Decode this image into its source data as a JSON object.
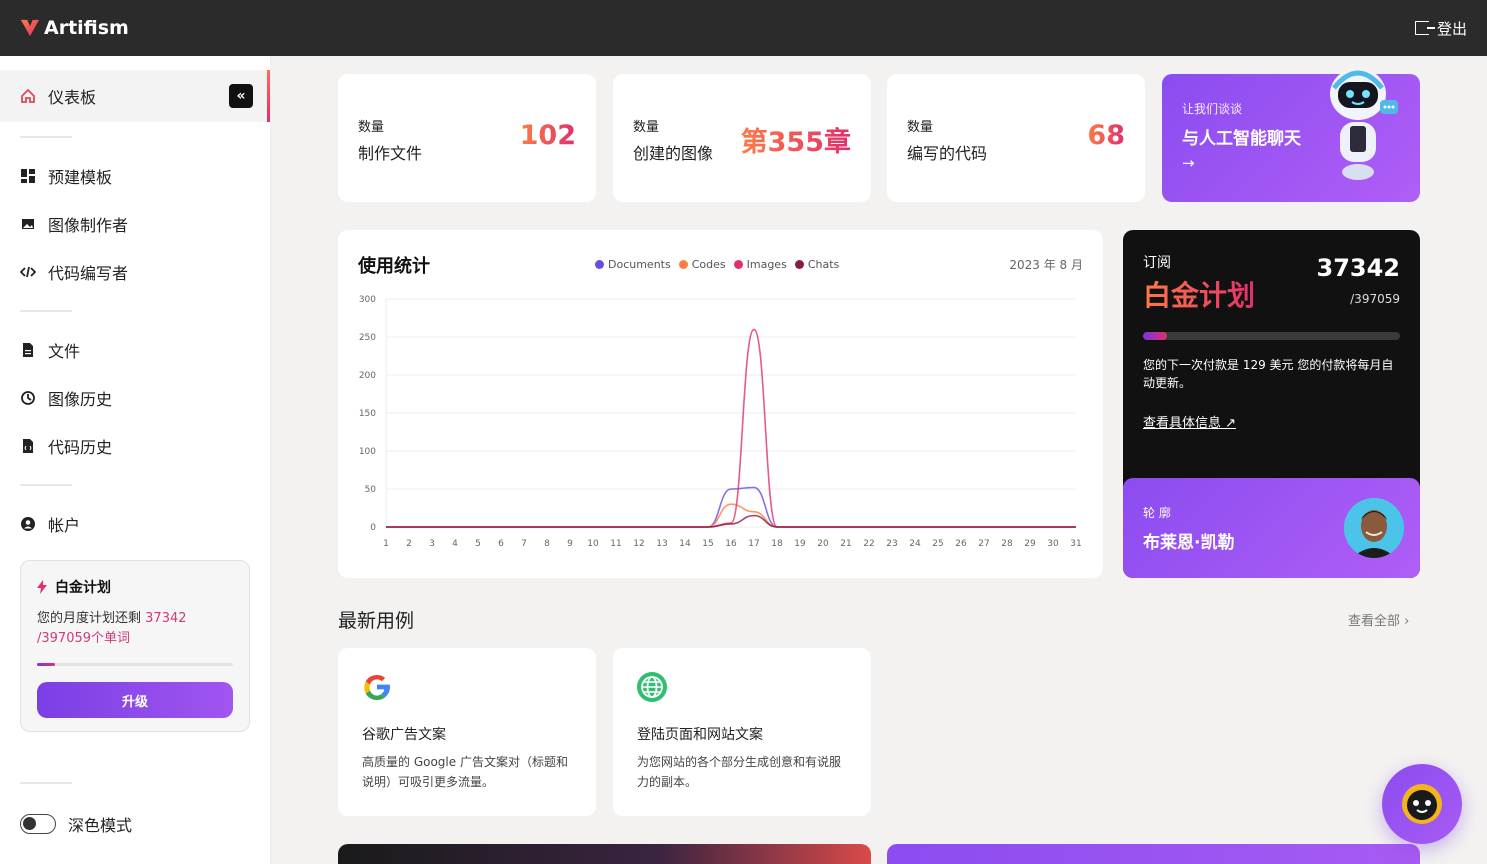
{
  "app": {
    "name": "Artifism",
    "logout_label": "登出"
  },
  "sidebar": {
    "collapse_label": "«",
    "items": [
      {
        "label": "仪表板",
        "icon": "home-icon"
      },
      {
        "label": "预建模板",
        "icon": "grid-icon"
      },
      {
        "label": "图像制作者",
        "icon": "image-icon"
      },
      {
        "label": "代码编写者",
        "icon": "code-icon"
      },
      {
        "label": "文件",
        "icon": "document-icon"
      },
      {
        "label": "图像历史",
        "icon": "history-icon"
      },
      {
        "label": "代码历史",
        "icon": "code-file-icon"
      },
      {
        "label": "帐户",
        "icon": "user-icon"
      }
    ],
    "plan": {
      "title": "白金计划",
      "desc_prefix": "您的月度计划还剩",
      "remaining": "37342",
      "total": "/397059个单词",
      "progress": 0.094,
      "upgrade_label": "升级"
    },
    "dark_mode_label": "深色模式"
  },
  "stats": [
    {
      "label": "数量",
      "name": "制作文件",
      "value": "102"
    },
    {
      "label": "数量",
      "name": "创建的图像",
      "value": "第355章"
    },
    {
      "label": "数量",
      "name": "编写的代码",
      "value": "68"
    }
  ],
  "chat_promo": {
    "eyebrow": "让我们谈谈",
    "title": "与人工智能聊天",
    "arrow": "→"
  },
  "chart": {
    "title": "使用统计",
    "date": "2023 年 8 月"
  },
  "chart_data": {
    "type": "line",
    "x": [
      1,
      2,
      3,
      4,
      5,
      6,
      7,
      8,
      9,
      10,
      11,
      12,
      13,
      14,
      15,
      16,
      17,
      18,
      19,
      20,
      21,
      22,
      23,
      24,
      25,
      26,
      27,
      28,
      29,
      30,
      31
    ],
    "ylim": [
      0,
      300
    ],
    "yticks": [
      0,
      50,
      100,
      150,
      200,
      250,
      300
    ],
    "legend_position": "top",
    "series": [
      {
        "name": "Documents",
        "color": "#6a4ce0",
        "values": [
          0,
          0,
          0,
          0,
          0,
          0,
          0,
          0,
          0,
          0,
          0,
          0,
          0,
          0,
          0,
          50,
          52,
          0,
          0,
          0,
          0,
          0,
          0,
          0,
          0,
          0,
          0,
          0,
          0,
          0,
          0
        ]
      },
      {
        "name": "Codes",
        "color": "#ff7a45",
        "values": [
          0,
          0,
          0,
          0,
          0,
          0,
          0,
          0,
          0,
          0,
          0,
          0,
          0,
          0,
          0,
          30,
          20,
          0,
          0,
          0,
          0,
          0,
          0,
          0,
          0,
          0,
          0,
          0,
          0,
          0,
          0
        ]
      },
      {
        "name": "Images",
        "color": "#e0306c",
        "values": [
          0,
          0,
          0,
          0,
          0,
          0,
          0,
          0,
          0,
          0,
          0,
          0,
          0,
          0,
          0,
          5,
          260,
          0,
          0,
          0,
          0,
          0,
          0,
          0,
          0,
          0,
          0,
          0,
          0,
          0,
          0
        ]
      },
      {
        "name": "Chats",
        "color": "#8a1d3c",
        "values": [
          0,
          0,
          0,
          0,
          0,
          0,
          0,
          0,
          0,
          0,
          0,
          0,
          0,
          0,
          0,
          4,
          15,
          0,
          0,
          0,
          0,
          0,
          0,
          0,
          0,
          0,
          0,
          0,
          0,
          0,
          0
        ]
      }
    ]
  },
  "subscription": {
    "label": "订阅",
    "plan": "白金计划",
    "remaining": "37342",
    "total": "/397059",
    "progress": 0.094,
    "note": "您的下一次付款是 129 美元 您的付款将每月自动更新。",
    "details_link": "查看具体信息 ↗"
  },
  "profile": {
    "label": "轮 廓",
    "name": "布莱恩·凯勒"
  },
  "recent": {
    "title": "最新用例",
    "view_all": "查看全部 ›",
    "items": [
      {
        "title": "谷歌广告文案",
        "desc": "高质量的 Google 广告文案对（标题和说明）可吸引更多流量。",
        "icon": "google-icon"
      },
      {
        "title": "登陆页面和网站文案",
        "desc": "为您网站的各个部分生成创意和有说服力的副本。",
        "icon": "globe-icon"
      }
    ]
  }
}
